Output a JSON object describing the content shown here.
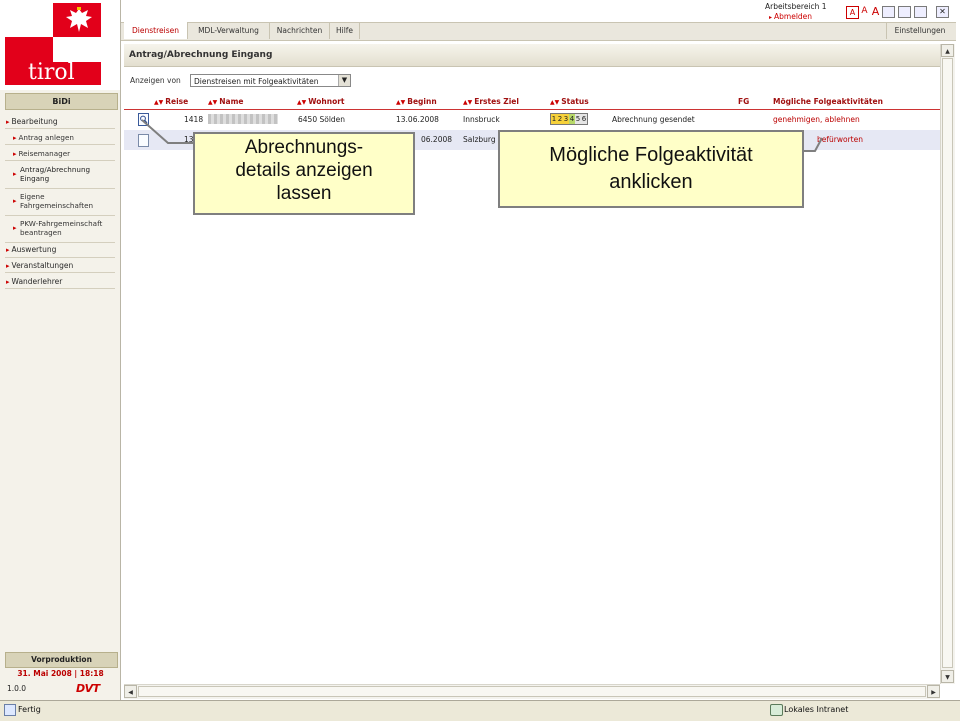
{
  "sidebar": {
    "logo_text": "tirol",
    "app_title": "BiDi",
    "nav": [
      {
        "label": "Bearbeitung",
        "level": 0
      },
      {
        "label": "Antrag anlegen",
        "level": 1
      },
      {
        "label": "Reisemanager",
        "level": 1
      },
      {
        "label": "Antrag/Abrechnung Eingang",
        "level": 1,
        "active": true
      },
      {
        "label": "Eigene Fahrgemeinschaften",
        "level": 1
      },
      {
        "label": "PKW-Fahrgemeinschaft beantragen",
        "level": 1
      },
      {
        "label": "Auswertung",
        "level": 0
      },
      {
        "label": "Veranstaltungen",
        "level": 0
      },
      {
        "label": "Wanderlehrer",
        "level": 0
      }
    ],
    "env_label": "Vorproduktion",
    "date_time": "31. Mai 2008 | 18:18",
    "version": "1.0.0",
    "vendor_logo": "DVT"
  },
  "header": {
    "workspace": "Arbeitsbereich 1",
    "logout": "Abmelden",
    "font_sizes": [
      "A",
      "A",
      "A"
    ],
    "tabs": [
      "Dienstreisen",
      "MDL-Verwaltung",
      "Nachrichten",
      "Hilfe"
    ],
    "active_tab": "Dienstreisen",
    "settings": "Einstellungen"
  },
  "main": {
    "title": "Antrag/Abrechnung Eingang",
    "filter_label": "Anzeigen von",
    "filter_value": "Dienstreisen mit Folgeaktivitäten",
    "columns": [
      "Reise",
      "Name",
      "Wohnort",
      "Beginn",
      "Erstes Ziel",
      "Status",
      "FG",
      "Mögliche Folgeaktivitäten"
    ],
    "rows": [
      {
        "reise": "1418",
        "wohnort": "6450 Sölden",
        "beginn": "13.06.2008",
        "ziel": "Innsbruck",
        "status_text": "Abrechnung gesendet",
        "actions": "genehmigen, ablehnen"
      },
      {
        "reise": "13",
        "wohnort": "",
        "beginn": "06.2008",
        "ziel": "Salzburg",
        "status_text": "",
        "actions": "befürworten"
      }
    ],
    "status_steps": [
      "1",
      "2",
      "3",
      "4",
      "5",
      "6"
    ]
  },
  "callouts": {
    "details": "Abrechnungs-\ndetails anzeigen\nlassen",
    "activity": "Mögliche Folgeaktivität\nanklicken"
  },
  "statusbar": {
    "status": "Fertig",
    "zone": "Lokales Intranet"
  },
  "colors": {
    "brand_red": "#e2001a",
    "link_red": "#b00000",
    "callout_fill": "#ffffc8"
  }
}
